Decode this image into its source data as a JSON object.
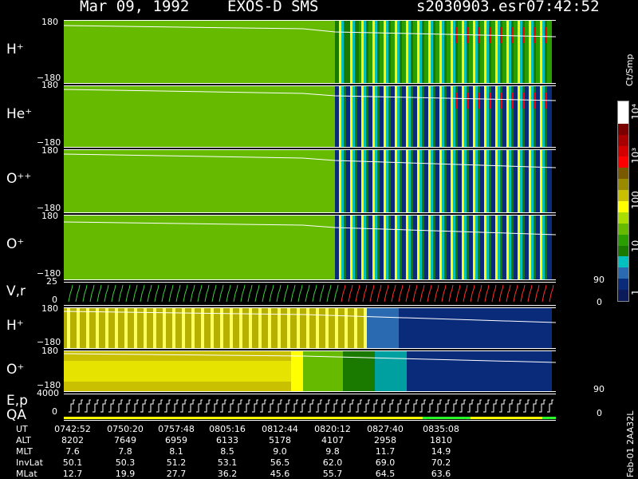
{
  "header": {
    "date": "Mar 09, 1992",
    "instrument": "EXOS-D SMS",
    "file": "s2030903.esr",
    "time": "07:42:52"
  },
  "colorbar": {
    "unit": "Ct/Smp",
    "ticks": [
      "10⁴",
      "10³",
      "100",
      "10",
      "1"
    ],
    "colors": [
      "#ffffff",
      "#ffffff",
      "#7a0000",
      "#a80000",
      "#d40000",
      "#ff0000",
      "#7a5a00",
      "#9a8a00",
      "#c8c000",
      "#ffff00",
      "#aadd00",
      "#66bb00",
      "#2a9d00",
      "#1a7a00",
      "#00c0c0",
      "#2a6ab0",
      "#0a2a7a",
      "#0a1a5a"
    ]
  },
  "panels": [
    {
      "label": "H⁺",
      "ymax": "180",
      "ymin": "−180"
    },
    {
      "label": "He⁺",
      "ymax": "180",
      "ymin": "−180"
    },
    {
      "label": "O⁺⁺",
      "ymax": "180",
      "ymin": "−180"
    },
    {
      "label": "O⁺",
      "ymax": "180",
      "ymin": "−180"
    },
    {
      "label": "V,r",
      "ymax": "25",
      "ymin": "0",
      "rmax": "90",
      "rmin": "0"
    },
    {
      "label": "H⁺",
      "ymax": "180",
      "ymin": "−180"
    },
    {
      "label": "O⁺",
      "ymax": "180",
      "ymin": "−180"
    },
    {
      "label": "E,p",
      "label2": "QA",
      "ymax": "4000",
      "ymin": "0",
      "rmax": "90",
      "rmin": "0"
    }
  ],
  "table": {
    "rows": [
      {
        "name": "UT",
        "values": [
          "0742:52",
          "0750:20",
          "0757:48",
          "0805:16",
          "0812:44",
          "0820:12",
          "0827:40",
          "0835:08"
        ]
      },
      {
        "name": "ALT",
        "values": [
          "8202",
          "7649",
          "6959",
          "6133",
          "5178",
          "4107",
          "2958",
          "1810"
        ]
      },
      {
        "name": "MLT",
        "values": [
          "7.6",
          "7.8",
          "8.1",
          "8.5",
          "9.0",
          "9.8",
          "11.7",
          "14.9"
        ]
      },
      {
        "name": "InvLat",
        "values": [
          "50.1",
          "50.3",
          "51.2",
          "53.1",
          "56.5",
          "62.0",
          "69.0",
          "70.2"
        ]
      },
      {
        "name": "MLat",
        "values": [
          "12.7",
          "19.9",
          "27.7",
          "36.2",
          "45.6",
          "55.7",
          "64.5",
          "63.6"
        ]
      }
    ]
  },
  "side_note": "Feb-01 2AA32L"
}
